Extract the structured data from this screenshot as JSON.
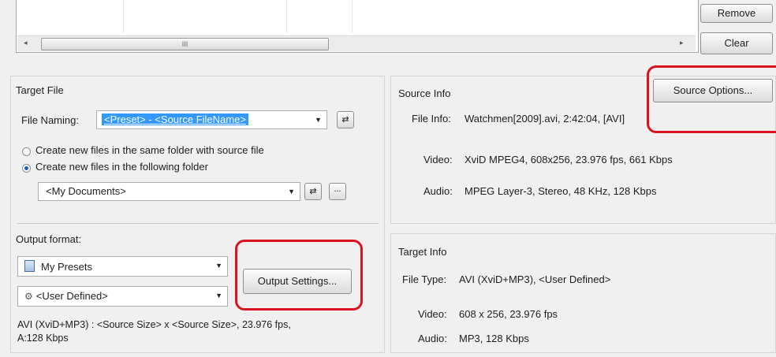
{
  "top": {
    "remove_label": "Remove",
    "clear_label": "Clear",
    "scroll_thumb_grip": "III",
    "scroll_left": "◂",
    "scroll_right": "▸"
  },
  "target_file": {
    "title": "Target File",
    "file_naming_label": "File Naming:",
    "file_naming_value": "<Preset> - <Source FileName>",
    "swap_icon": "⇄",
    "radio_same_folder": "Create new files in the same folder with source file",
    "radio_following_folder": "Create new files in the following folder",
    "folder_value": "<My Documents>",
    "browse_label": "..."
  },
  "output_format": {
    "title": "Output format:",
    "preset_value": "My Presets",
    "profile_value": "<User Defined>",
    "output_settings_label": "Output Settings...",
    "summary_line1": "AVI (XviD+MP3) : <Source Size> x <Source Size>, 23.976 fps,",
    "summary_line2": "A:128 Kbps"
  },
  "source_info": {
    "title": "Source Info",
    "source_options_label": "Source Options...",
    "file_info_label": "File Info:",
    "file_info_value": "Watchmen[2009].avi, 2:42:04,  [AVI]",
    "video_label": "Video:",
    "video_value": "XviD MPEG4, 608x256, 23.976 fps, 661 Kbps",
    "audio_label": "Audio:",
    "audio_value": "MPEG Layer-3, Stereo, 48 KHz, 128 Kbps"
  },
  "target_info": {
    "title": "Target Info",
    "file_type_label": "File Type:",
    "file_type_value": "AVI (XviD+MP3), <User Defined>",
    "video_label": "Video:",
    "video_value": "608 x 256, 23.976 fps",
    "audio_label": "Audio:",
    "audio_value": "MP3, 128 Kbps"
  },
  "colors": {
    "highlight": "#d9141f",
    "selection": "#3399ff"
  }
}
